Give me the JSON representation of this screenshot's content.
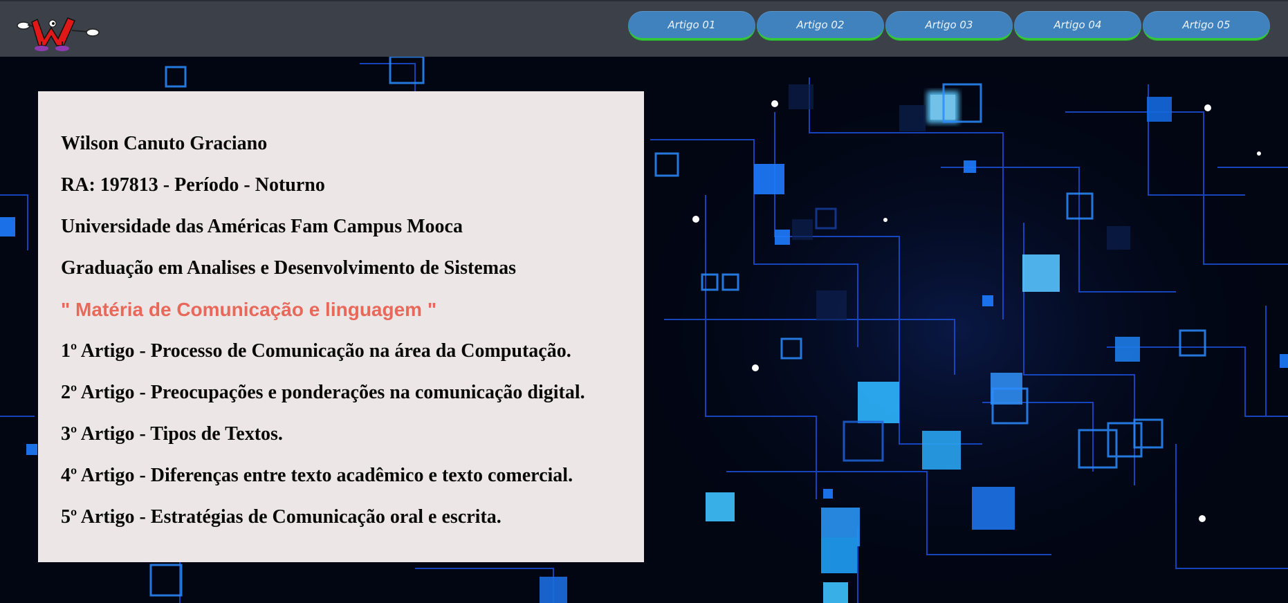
{
  "header": {
    "logo_icon": "cartoon-w-mascot-logo",
    "nav": [
      {
        "label": "Artigo 01"
      },
      {
        "label": "Artigo 02"
      },
      {
        "label": "Artigo 03"
      },
      {
        "label": "Artigo 04"
      },
      {
        "label": "Artigo 05"
      }
    ]
  },
  "panel": {
    "name": "Wilson Canuto Graciano",
    "ra": "RA: 197813 - Período - Noturno",
    "university": "Universidade das Américas Fam Campus Mooca",
    "course": "Graduação em Analises e Desenvolvimento de Sistemas",
    "subject": "\" Matéria de Comunicação e linguagem \"",
    "articles": [
      "1º Artigo - Processo de Comunicação na área da Computação.",
      "2º Artigo - Preocupações e ponderações na comunicação digital.",
      "3º Artigo - Tipos de Textos.",
      "4º Artigo - Diferenças entre texto acadêmico e texto comercial.",
      "5º Artigo - Estratégias de Comunicação oral e escrita."
    ]
  },
  "colors": {
    "topbar": "#3c4049",
    "nav_button": "#3f82bd",
    "nav_border": "#35c93a",
    "panel": "#ede6e6",
    "accent_text": "#e8685a"
  }
}
